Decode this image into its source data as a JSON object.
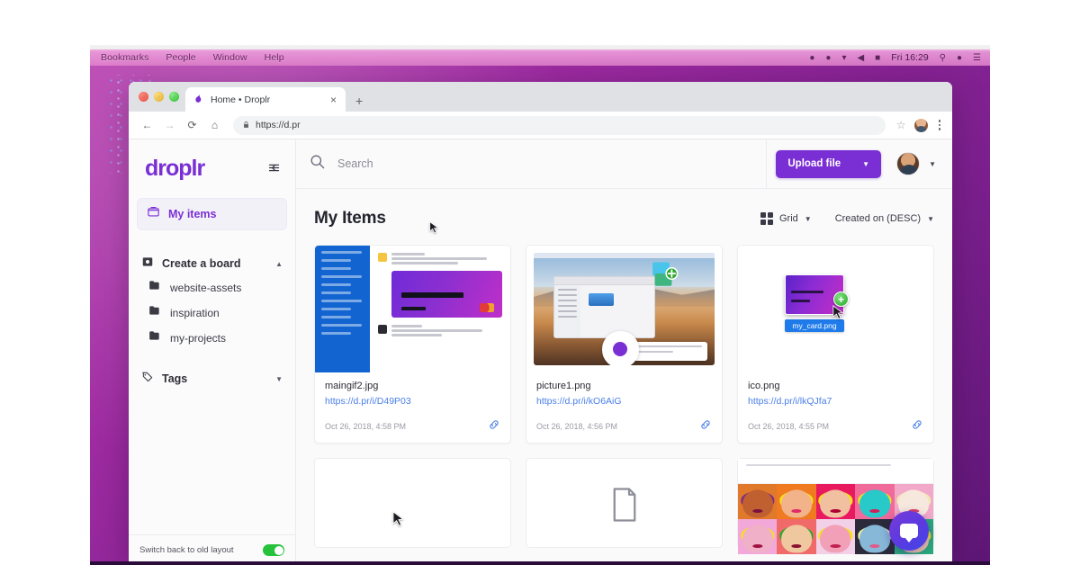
{
  "os": {
    "menu_items": [
      "Bookmarks",
      "People",
      "Window",
      "Help"
    ],
    "status_icons": [
      "dropbox-icon",
      "shield-icon",
      "wifi-icon",
      "volume-icon",
      "battery-icon"
    ],
    "clock": "Fri 16:29",
    "right_icons": [
      "search-icon",
      "dropbox-icon",
      "list-icon"
    ]
  },
  "browser": {
    "tab_title": "Home • Droplr",
    "tab_close_label": "×",
    "new_tab_label": "+",
    "back_label": "←",
    "forward_label": "→",
    "reload_label": "⟳",
    "home_label": "⌂",
    "lock_label": "🔒",
    "url": "https://d.pr",
    "star_label": "☆"
  },
  "sidebar": {
    "logo": "droplr",
    "collapse_label": "⇤",
    "nav_active": {
      "label": "My items",
      "icon": "archive-icon"
    },
    "board_section": {
      "label": "Create a board",
      "icon": "board-icon",
      "caret": "▲"
    },
    "folders": [
      {
        "label": "website-assets",
        "icon": "folder-icon"
      },
      {
        "label": "inspiration",
        "icon": "folder-icon"
      },
      {
        "label": "my-projects",
        "icon": "folder-icon"
      }
    ],
    "tags_section": {
      "label": "Tags",
      "icon": "tag-icon",
      "caret": "▼"
    },
    "footer": {
      "label": "Switch back to old layout",
      "toggle_on": true
    }
  },
  "topbar": {
    "search_placeholder": "Search",
    "search_value": "",
    "upload_label": "Upload file",
    "upload_caret": "▼",
    "avatar_caret": "▼",
    "accent_color": "#7a2fd4"
  },
  "content": {
    "title": "My Items",
    "view_mode": {
      "label": "Grid",
      "caret": "▼"
    },
    "sort": {
      "label": "Created on (DESC)",
      "caret": "▼"
    },
    "items": [
      {
        "name": "maingif2.jpg",
        "url": "https://d.pr/i/D49P03",
        "date": "Oct 26, 2018, 4:58 PM",
        "thumb": "slack-conversation-screenshot",
        "link_icon": "link-icon"
      },
      {
        "name": "picture1.png",
        "url": "https://d.pr/i/kO6AiG",
        "date": "Oct 26, 2018, 4:56 PM",
        "thumb": "macos-desktop-screenshot",
        "link_icon": "link-icon"
      },
      {
        "name": "ico.png",
        "url": "https://d.pr/i/lkQJfa7",
        "date": "Oct 26, 2018, 4:55 PM",
        "thumb": "card-image-with-drag-ghost",
        "link_icon": "link-icon"
      }
    ],
    "row2": [
      {
        "thumb": "empty"
      },
      {
        "thumb": "document-icon"
      },
      {
        "thumb": "warhol-marilyn-grid"
      }
    ]
  },
  "drag": {
    "file_label": "my_card.png",
    "badge": "+",
    "badge_color": "#2aa82a",
    "label_bg": "#1f7bea"
  },
  "chat": {
    "icon": "chat-bubble-icon",
    "gradient_from": "#7a3ad8",
    "gradient_to": "#3f46e8"
  }
}
